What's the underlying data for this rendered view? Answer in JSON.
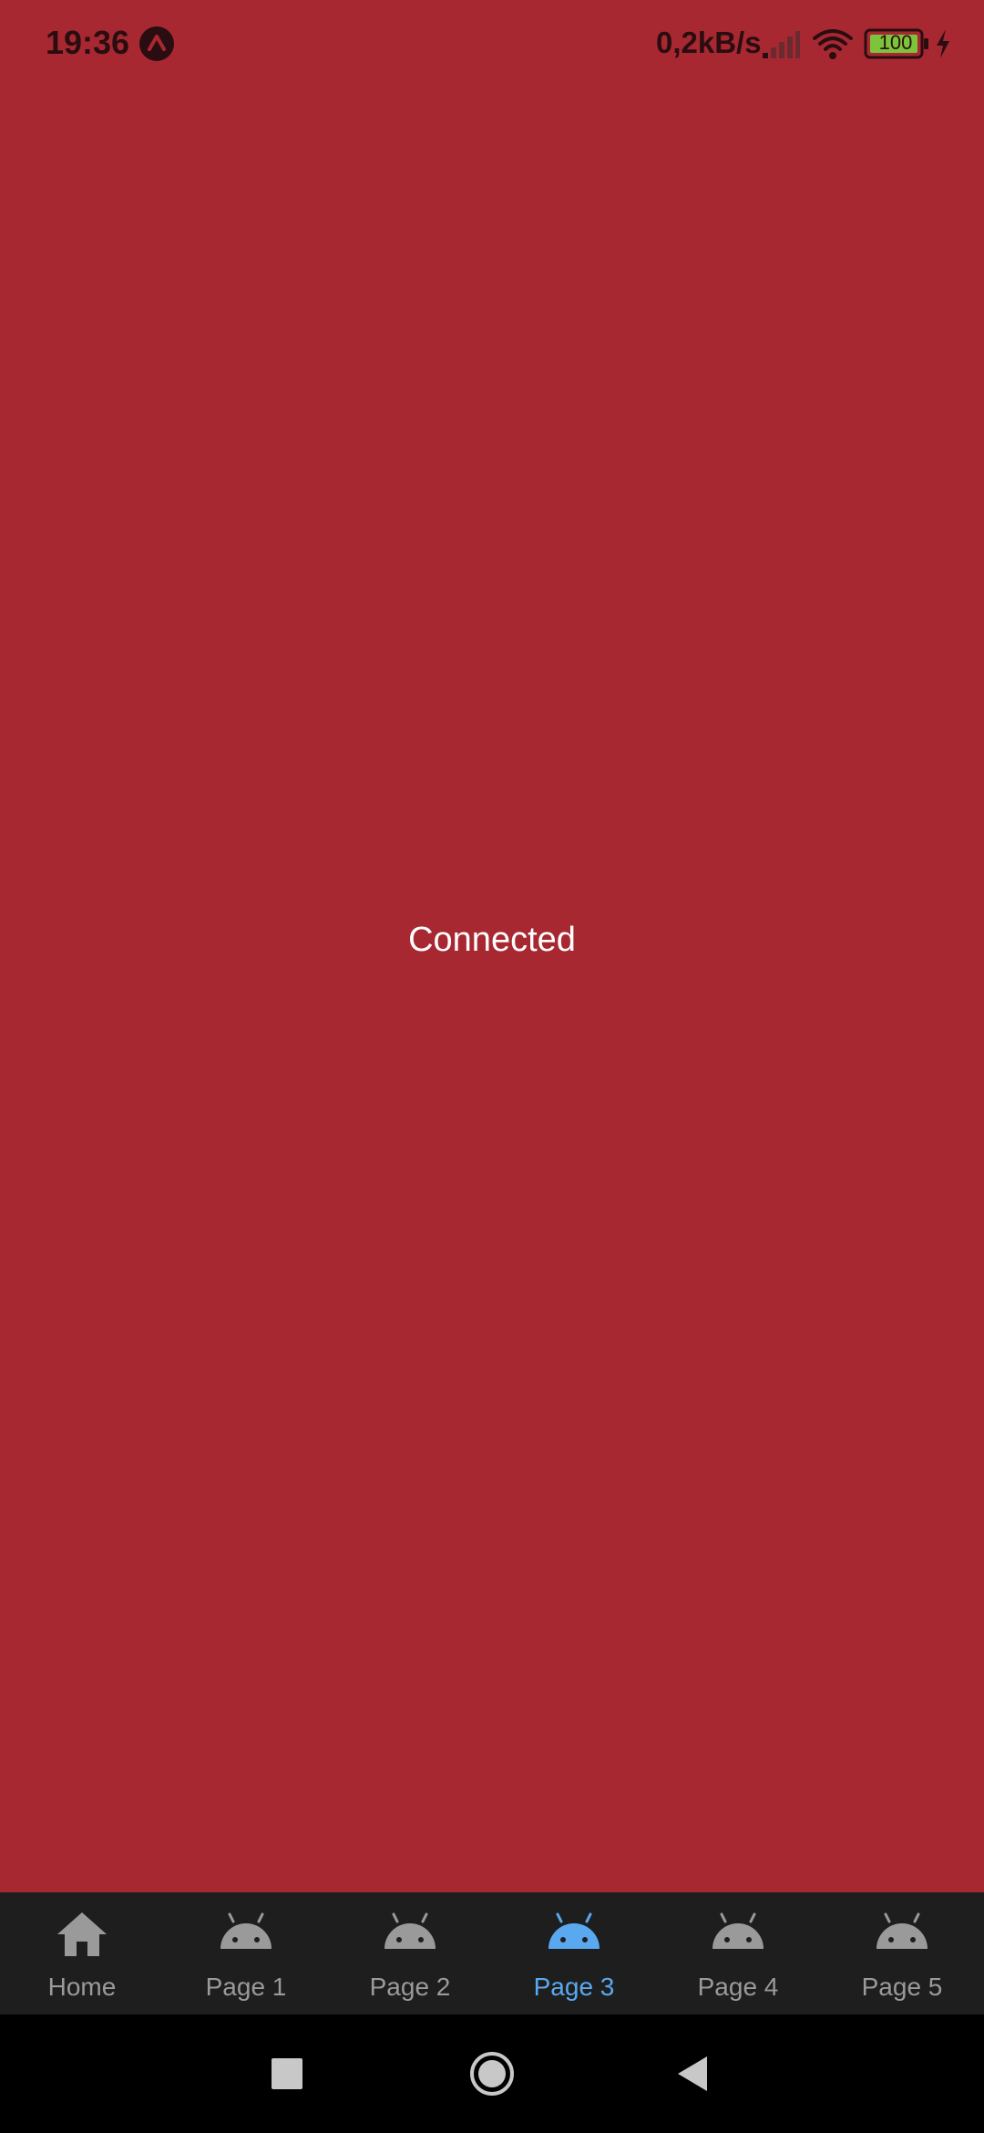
{
  "status_bar": {
    "time": "19:36",
    "network_speed": "0,2kB/s",
    "battery_level": "100",
    "icons": [
      "app-notification-icon",
      "signal-icon",
      "wifi-icon",
      "battery-icon",
      "charging-icon"
    ]
  },
  "main": {
    "status_text": "Connected",
    "background_color": "#a82832"
  },
  "tab_bar": {
    "active_index": 3,
    "active_color": "#5aa9f0",
    "inactive_color": "#9a9a9a",
    "tabs": [
      {
        "label": "Home",
        "icon": "home-icon"
      },
      {
        "label": "Page 1",
        "icon": "android-icon"
      },
      {
        "label": "Page 2",
        "icon": "android-icon"
      },
      {
        "label": "Page 3",
        "icon": "android-icon"
      },
      {
        "label": "Page 4",
        "icon": "android-icon"
      },
      {
        "label": "Page 5",
        "icon": "android-icon"
      }
    ]
  },
  "nav_bar": {
    "buttons": [
      "recents-icon",
      "home-button-icon",
      "back-icon"
    ]
  }
}
